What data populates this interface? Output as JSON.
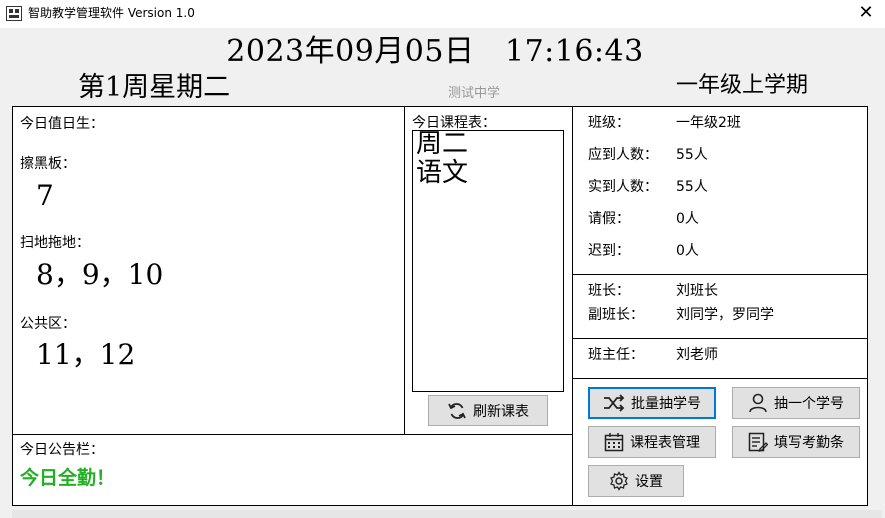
{
  "window": {
    "title": "智助教学管理软件 Version 1.0",
    "close": "✕"
  },
  "header": {
    "datetime": "2023年09月05日　17:16:43",
    "week": "第1周星期二",
    "school": "测试中学",
    "term": "一年级上学期"
  },
  "duty": {
    "title": "今日值日生：",
    "groups": [
      {
        "label": "擦黑板：",
        "value": "7"
      },
      {
        "label": "扫地拖地：",
        "value": "8，9，10"
      },
      {
        "label": "公共区：",
        "value": "11，12"
      }
    ]
  },
  "schedule": {
    "title": "今日课程表：",
    "content": "周二\n语文",
    "refresh_button": "刷新课表"
  },
  "notice": {
    "title": "今日公告栏：",
    "text": "今日全勤！"
  },
  "class_info": [
    {
      "key": "班级：",
      "value": "一年级2班"
    },
    {
      "key": "应到人数：",
      "value": "55人"
    },
    {
      "key": "实到人数：",
      "value": "55人"
    },
    {
      "key": "请假：",
      "value": "0人"
    },
    {
      "key": "迟到：",
      "value": "0人"
    }
  ],
  "leaders": [
    {
      "key": "班长：",
      "value": "刘班长"
    },
    {
      "key": "副班长：",
      "value": "刘同学，罗同学"
    }
  ],
  "teacher": {
    "key": "班主任：",
    "value": "刘老师"
  },
  "buttons": {
    "batch_draw": "批量抽学号",
    "draw_one": "抽一个学号",
    "schedule_manage": "课程表管理",
    "attendance": "填写考勤条",
    "settings": "设置"
  },
  "colors": {
    "notice": "#22b022",
    "focus_border": "#0078d7",
    "button_bg": "#e1e1e1"
  }
}
